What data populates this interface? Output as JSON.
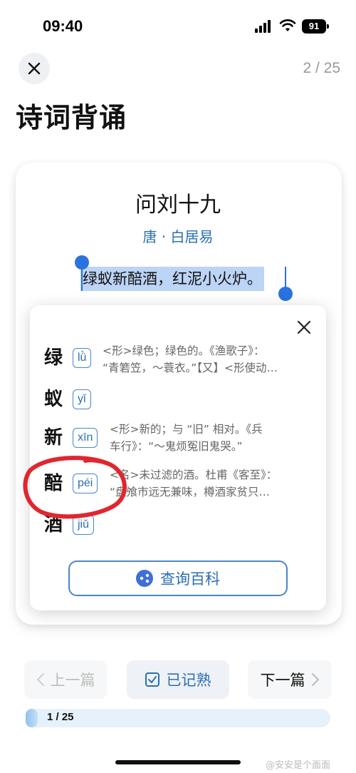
{
  "status_bar": {
    "time": "09:40",
    "battery": "91"
  },
  "header": {
    "progress": "2 / 25",
    "title": "诗词背诵"
  },
  "poem": {
    "title": "问刘十九",
    "author": "唐 · 白居易",
    "selected_line": "绿蚁新醅酒，红泥小火炉。"
  },
  "dictionary_popup": {
    "entries": [
      {
        "char": "绿",
        "pinyin": "lǜ",
        "def_line1": "<形>绿色；绿色的。《渔歌子》：",
        "def_line2": "“青箬笠，～蓑衣。”【又】<形使动…"
      },
      {
        "char": "蚁",
        "pinyin": "yǐ",
        "def_line1": "",
        "def_line2": ""
      },
      {
        "char": "新",
        "pinyin": "xīn",
        "def_line1": "<形>新的；与 “旧” 相对。《兵",
        "def_line2": "车行》：“～鬼烦冤旧鬼哭。”"
      },
      {
        "char": "醅",
        "pinyin": "péi",
        "def_line1": "<名>未过滤的酒。杜甫《客至》：",
        "def_line2": "“盘飧市远无兼味，樽酒家贫只…"
      },
      {
        "char": "酒",
        "pinyin": "jiǔ",
        "def_line1": "",
        "def_line2": ""
      }
    ],
    "baike_label": "查询百科"
  },
  "footer": {
    "prev_label": "上一篇",
    "mark_label": "已记熟",
    "next_label": "下一篇",
    "progress_text": "1 / 25",
    "progress_fraction": 0.04
  },
  "watermark": "@安安是个面面",
  "colors": {
    "accent": "#2c6fb5",
    "selection": "#bcd4f5",
    "handle": "#2a72e0",
    "annotation": "#e0262f"
  }
}
